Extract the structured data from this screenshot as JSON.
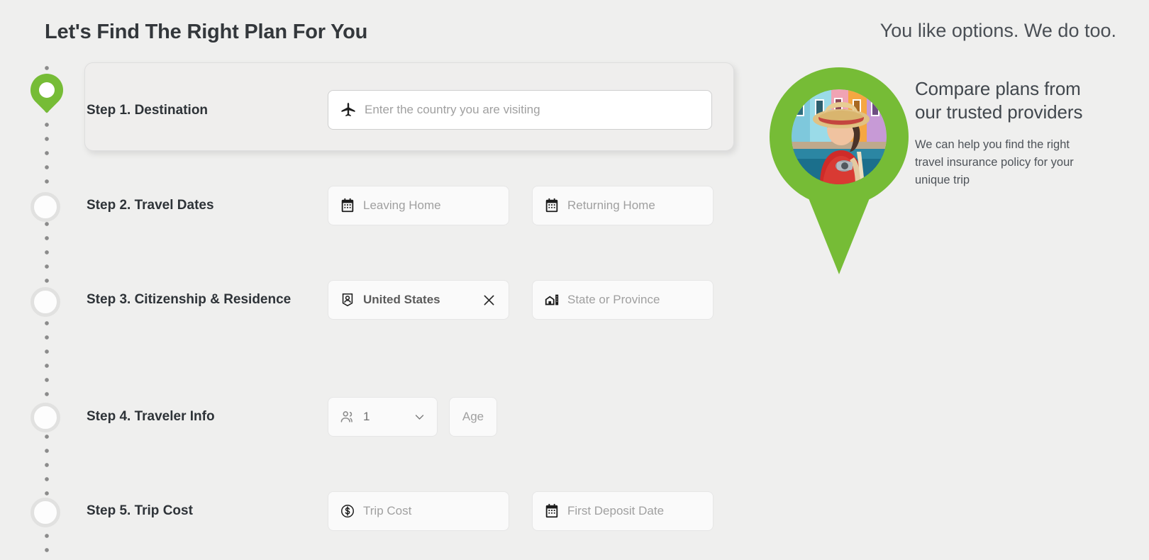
{
  "headline": "Let's Find The Right Plan For You",
  "tagline": "You like options. We do too.",
  "steps": [
    {
      "label": "Step 1. Destination",
      "fields": [
        {
          "icon": "airplane-icon",
          "placeholder": "Enter the country you are visiting"
        }
      ]
    },
    {
      "label": "Step 2. Travel Dates",
      "fields": [
        {
          "icon": "calendar-icon",
          "placeholder": "Leaving Home"
        },
        {
          "icon": "calendar-icon",
          "placeholder": "Returning Home"
        }
      ]
    },
    {
      "label": "Step 3. Citizenship & Residence",
      "fields": [
        {
          "icon": "passport-icon",
          "value": "United States",
          "clear": "×"
        },
        {
          "icon": "building-icon",
          "placeholder": "State or Province"
        }
      ]
    },
    {
      "label": "Step 4. Traveler Info",
      "fields": [
        {
          "icon": "travelers-icon",
          "value": "1"
        },
        {
          "placeholder": "Age"
        }
      ]
    },
    {
      "label": "Step 5. Trip Cost",
      "fields": [
        {
          "icon": "dollar-icon",
          "placeholder": "Trip Cost"
        },
        {
          "icon": "calendar-icon",
          "placeholder": "First Deposit Date"
        }
      ]
    }
  ],
  "promo": {
    "title": "Compare plans from our trusted providers",
    "subtitle": "We can help you find the right travel insurance policy for your unique trip",
    "photo_alt": "woman-traveler-photo"
  },
  "colors": {
    "brand_green": "#76bc36",
    "background": "#efefee",
    "text_dark": "#33373b",
    "placeholder": "#a0a0a0"
  }
}
